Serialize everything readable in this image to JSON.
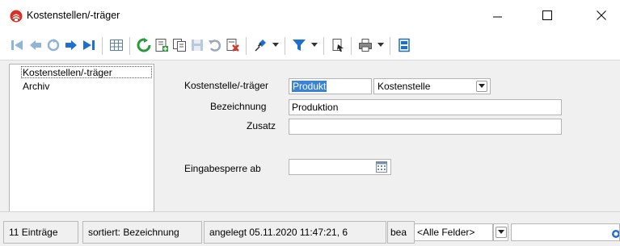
{
  "window": {
    "title": "Kostenstellen/-träger"
  },
  "toolbar": {
    "buttons": [
      "first-record-icon",
      "previous-record-icon",
      "refresh-small-icon",
      "next-record-icon",
      "last-record-icon",
      "table-view-icon",
      "reload-icon",
      "new-record-icon",
      "copy-record-icon",
      "save-icon",
      "undo-icon",
      "delete-icon",
      "pin-icon",
      "filter-icon",
      "export-icon",
      "print-icon",
      "settings-icon"
    ]
  },
  "nav": {
    "items": [
      {
        "label": "Kostenstellen/-träger"
      },
      {
        "label": "Archiv"
      }
    ]
  },
  "form": {
    "kostenstelle_label": "Kostenstelle/-träger",
    "kostenstelle_value": "Produkt",
    "kostenstelle_type": "Kostenstelle",
    "bezeichnung_label": "Bezeichnung",
    "bezeichnung_value": "Produktion",
    "zusatz_label": "Zusatz",
    "zusatz_value": "",
    "eingabesperre_label": "Eingabesperre ab",
    "eingabesperre_value": ""
  },
  "status": {
    "count": "11 Einträge",
    "sort": "sortiert: Bezeichnung",
    "created": "angelegt 05.11.2020 11:47:21, 6",
    "bea": "bea",
    "fields_filter": "<Alle Felder>",
    "search_value": ""
  },
  "colors": {
    "selection": "#3a82d4",
    "panel_bg": "#f0f0f0",
    "border": "#b4b4b4",
    "accent_blue": "#1f6fd1",
    "accent_green": "#2a9a3c",
    "accent_red": "#d6352b"
  }
}
